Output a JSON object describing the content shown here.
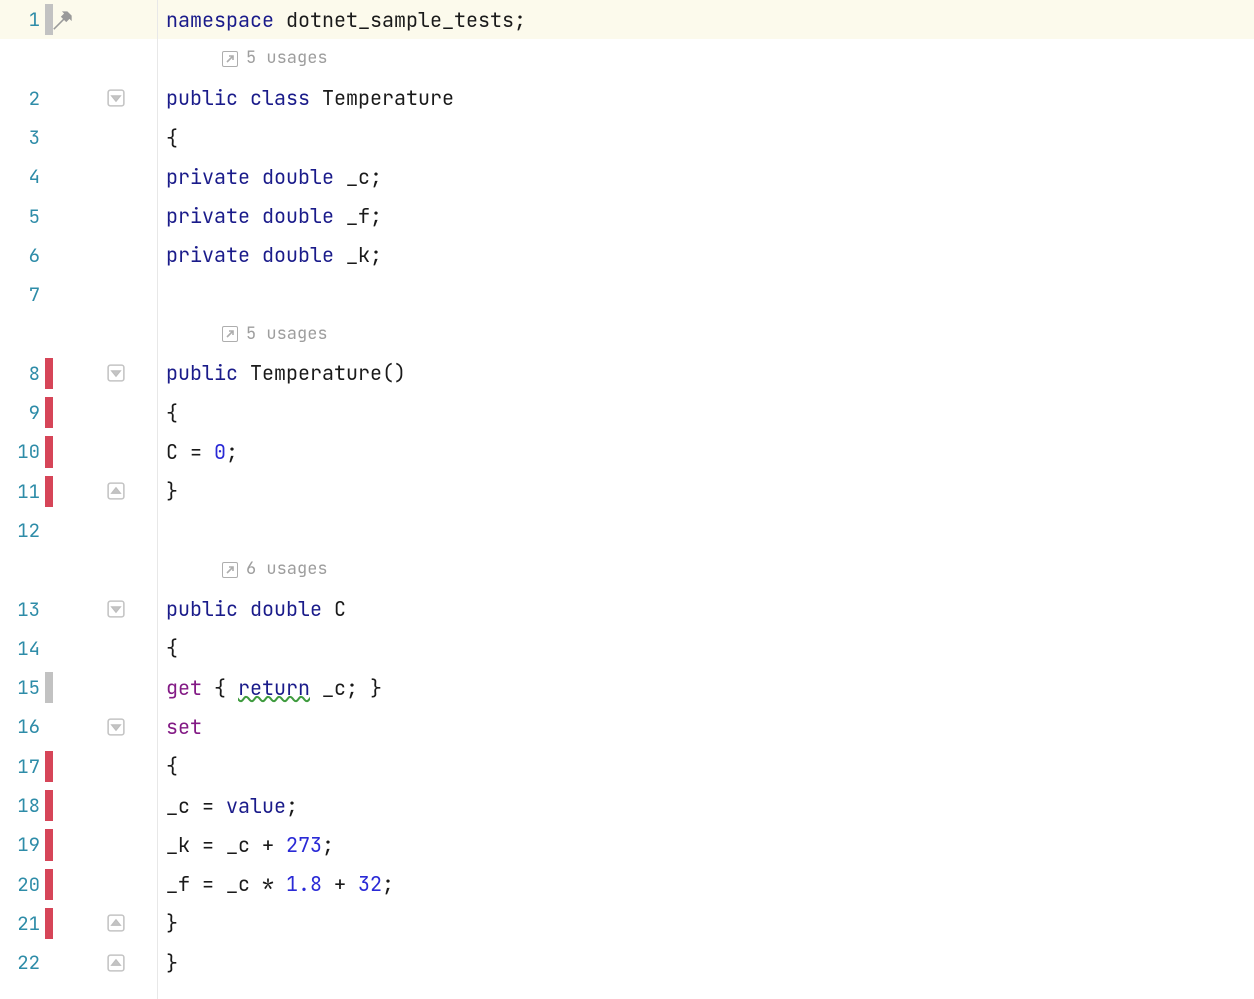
{
  "lines": {
    "l1": "1",
    "l2": "2",
    "l3": "3",
    "l4": "4",
    "l5": "5",
    "l6": "6",
    "l7": "7",
    "l8": "8",
    "l9": "9",
    "l10": "10",
    "l11": "11",
    "l12": "12",
    "l13": "13",
    "l14": "14",
    "l15": "15",
    "l16": "16",
    "l17": "17",
    "l18": "18",
    "l19": "19",
    "l20": "20",
    "l21": "21",
    "l22": "22"
  },
  "usages": {
    "class": "5 usages",
    "ctor": "5 usages",
    "prop": "6 usages"
  },
  "code": {
    "namespace_kw": "namespace",
    "namespace_name": " dotnet_sample_tests;",
    "public_kw": "public",
    "class_kw": " class",
    "class_name": " Temperature",
    "brace_open": "{",
    "brace_close": "}",
    "private_kw": "private",
    "double_kw": " double",
    "field_c": " _c;",
    "field_f": " _f;",
    "field_k": " _k;",
    "ctor_name": " Temperature()",
    "ctor_body": "C = ",
    "ctor_zero": "0",
    "semicolon": ";",
    "prop_name": " C",
    "get_kw": "get",
    "get_body_open": " { ",
    "return_kw": "return",
    "return_val": " _c; }",
    "set_kw": "set",
    "assign_c": "_c = ",
    "value_kw": "value",
    "assign_k_lhs": "_k = _c + ",
    "assign_k_rhs": "273",
    "assign_f_lhs": "_f = _c * ",
    "assign_f_mid": "1.8",
    "assign_f_plus": " + ",
    "assign_f_rhs": "32"
  }
}
